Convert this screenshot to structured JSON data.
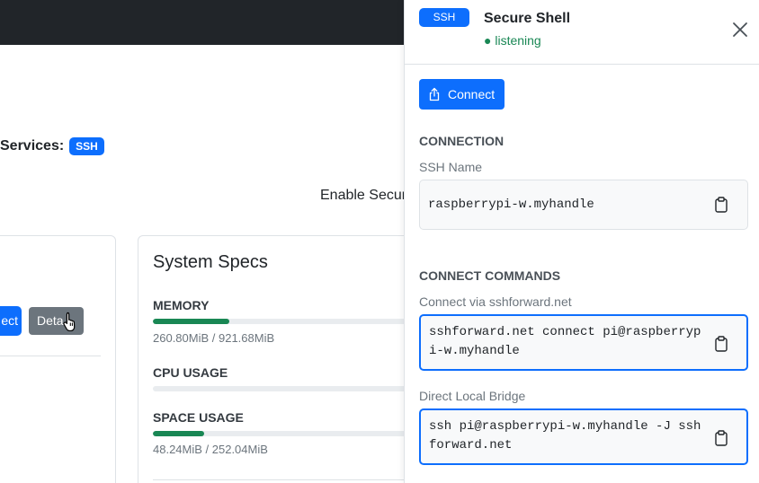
{
  "background": {
    "services_label": "Services:",
    "services_badge": "SSH",
    "enable_text": "Enable Secur",
    "connect_button_fragment": "ect",
    "details_button_fragment": "Deta",
    "system_specs": {
      "title": "System Specs",
      "memory": {
        "label": "MEMORY",
        "value": "260.80MiB / 921.68MiB",
        "fill_fraction": 0.283
      },
      "cpu": {
        "label": "CPU USAGE",
        "fill_fraction": 0.0
      },
      "space": {
        "label": "SPACE USAGE",
        "value": "48.24MiB / 252.04MiB",
        "fill_fraction": 0.191
      }
    }
  },
  "panel": {
    "badge": "SSH",
    "title": "Secure Shell",
    "status": "● listening",
    "status_color": "#198754",
    "connect_button": "Connect",
    "connection": {
      "heading": "CONNECTION",
      "ssh_name_label": "SSH Name",
      "ssh_name_value": "raspberrypi-w.myhandle"
    },
    "commands": {
      "heading": "CONNECT COMMANDS",
      "via_label": "Connect via sshforward.net",
      "via_value": "sshforward.net connect pi@raspberrypi-w.myhandle",
      "bridge_label": "Direct Local Bridge",
      "bridge_value": "ssh pi@raspberrypi-w.myhandle -J sshforward.net"
    }
  },
  "colors": {
    "accent": "#0d6efd",
    "success": "#198754",
    "secondary": "#6c757d",
    "topbar": "#212529"
  },
  "icons": [
    "close-icon",
    "share-icon",
    "clipboard-icon",
    "hand-cursor-icon"
  ]
}
